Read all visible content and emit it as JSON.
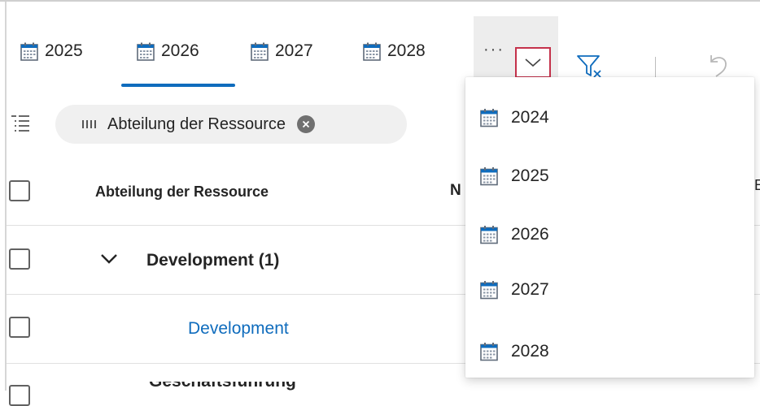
{
  "toolbar": {
    "year_tabs": [
      {
        "label": "2025",
        "selected": false
      },
      {
        "label": "2026",
        "selected": true
      },
      {
        "label": "2027",
        "selected": false
      },
      {
        "label": "2028",
        "selected": false
      }
    ],
    "more_label": "···",
    "accent_color": "#0f6cbd",
    "focus_border_color": "#c4314b"
  },
  "group_by": {
    "chip_label": "Abteilung der Ressource"
  },
  "grid": {
    "columns": [
      "Abteilung der Ressource",
      "N",
      "E"
    ],
    "rows": [
      {
        "type": "group",
        "label": "Development (1)"
      },
      {
        "type": "item",
        "label": "Development"
      },
      {
        "type": "group",
        "label": "Geschäftsführung"
      }
    ]
  },
  "year_menu": {
    "items": [
      "2024",
      "2025",
      "2026",
      "2027",
      "2028"
    ]
  }
}
